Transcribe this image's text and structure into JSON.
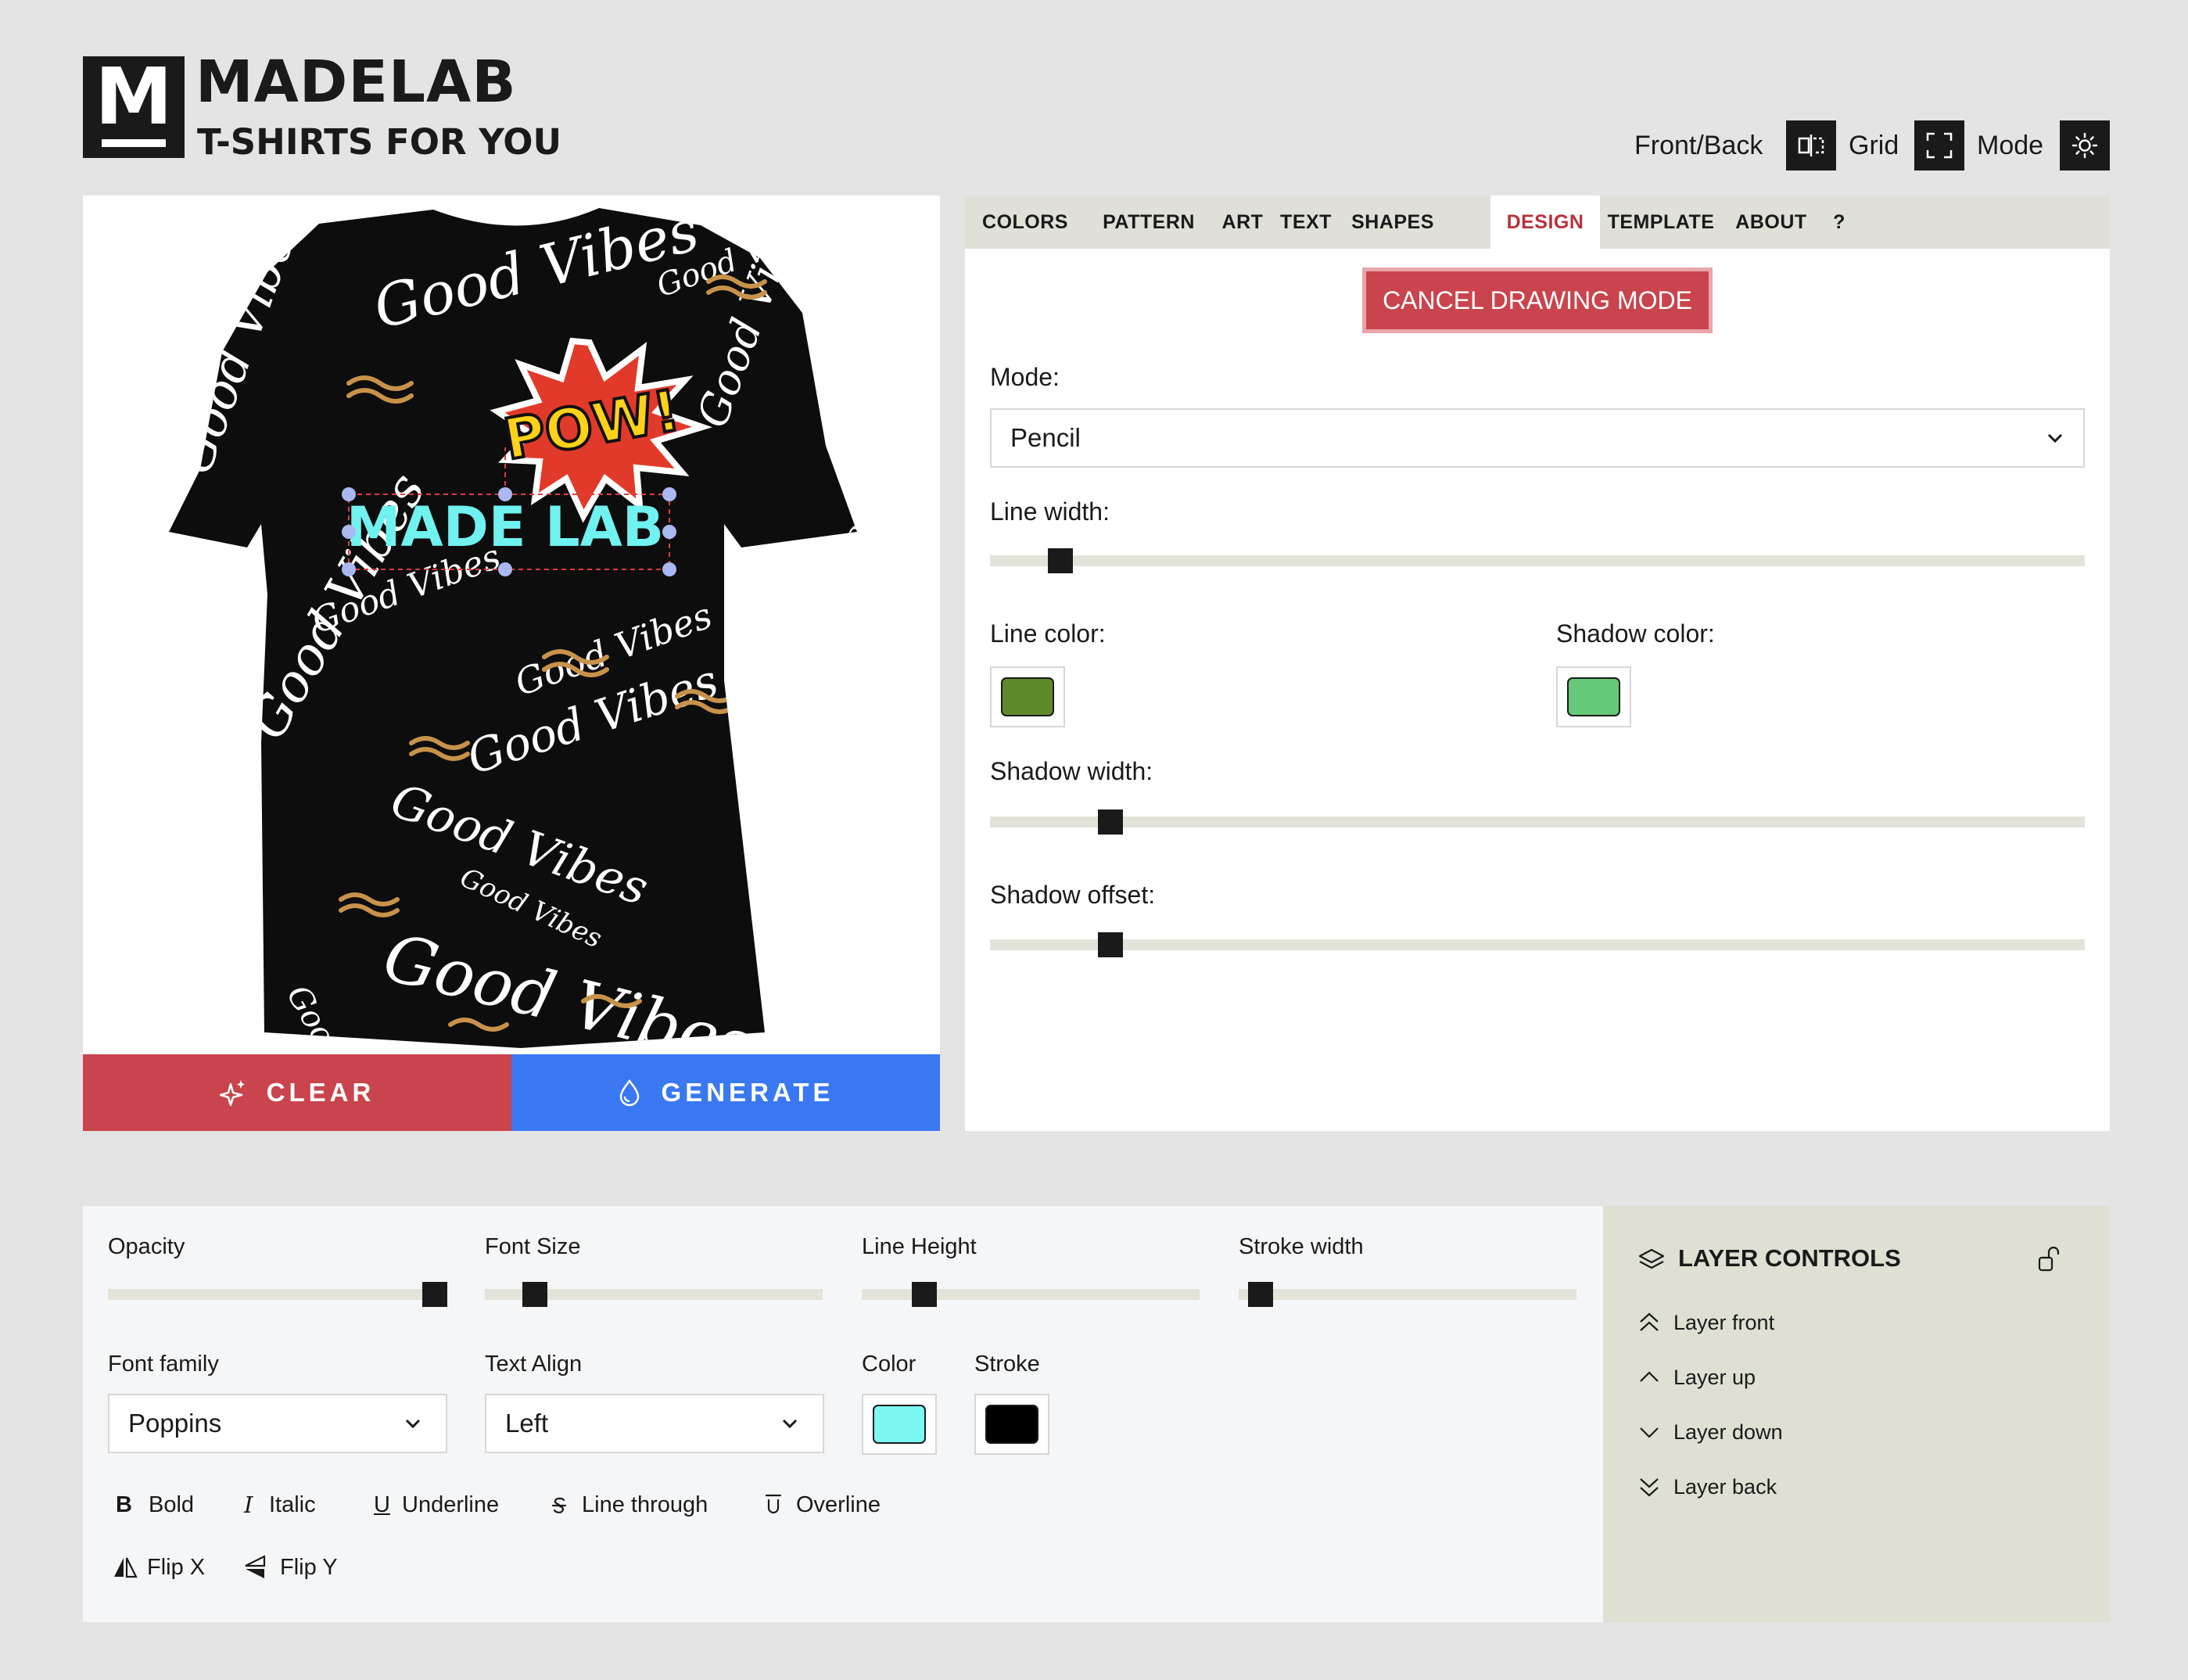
{
  "brand": {
    "logo_letter": "M",
    "title": "MADELAB",
    "subtitle": "T-SHIRTS FOR YOU"
  },
  "toolbar": {
    "front_back": "Front/Back",
    "grid": "Grid",
    "mode": "Mode"
  },
  "canvas": {
    "badge_text": "POW!",
    "selected_text": "MADE LAB",
    "pattern_text": "Good Vibes"
  },
  "actions": {
    "clear": "CLEAR",
    "generate": "GENERATE"
  },
  "tabs": [
    "COLORS",
    "PATTERN",
    "ART",
    "TEXT",
    "SHAPES",
    "DESIGN",
    "TEMPLATE",
    "ABOUT",
    "?"
  ],
  "active_tab": "DESIGN",
  "design": {
    "cancel_label": "CANCEL DRAWING MODE",
    "mode_label": "Mode:",
    "mode_value": "Pencil",
    "line_width_label": "Line width:",
    "line_width_level": 0.06,
    "line_color_label": "Line color:",
    "line_color": "#5f8a2a",
    "shadow_color_label": "Shadow color:",
    "shadow_color": "#66c97a",
    "shadow_width_label": "Shadow width:",
    "shadow_width_level": 0.1,
    "shadow_offset_label": "Shadow offset:",
    "shadow_offset_level": 0.1
  },
  "text_controls": {
    "opacity_label": "Opacity",
    "opacity_level": 0.96,
    "font_size_label": "Font Size",
    "font_size_level": 0.12,
    "line_height_label": "Line Height",
    "line_height_level": 0.16,
    "stroke_width_label": "Stroke width",
    "stroke_width_level": 0.05,
    "font_family_label": "Font family",
    "font_family_value": "Poppins",
    "text_align_label": "Text Align",
    "text_align_value": "Left",
    "color_label": "Color",
    "color_value": "#7df7f2",
    "stroke_label": "Stroke",
    "stroke_value": "#000000",
    "bold": "Bold",
    "bold_glyph": "B",
    "italic": "Italic",
    "italic_glyph": "I",
    "underline": "Underline",
    "underline_glyph": "U",
    "line_through": "Line through",
    "overline": "Overline",
    "flip_x": "Flip X",
    "flip_y": "Flip Y"
  },
  "layers": {
    "title": "LAYER CONTROLS",
    "front": "Layer front",
    "up": "Layer up",
    "down": "Layer down",
    "back": "Layer back"
  },
  "colors": {
    "accent_red": "#c9444c",
    "accent_blue": "#3a78f2",
    "active_tab": "#b8313b",
    "text_cyan": "#6ff2f0"
  },
  "icons": [
    "front-back-icon",
    "grid-icon",
    "sun-icon",
    "sparkle-icon",
    "drop-icon",
    "chevron-down-icon",
    "layers-icon",
    "unlock-icon",
    "double-chevron-up-icon",
    "chevron-up-icon",
    "chevron-down-icon",
    "double-chevron-down-icon",
    "strikethrough-icon",
    "overline-icon",
    "flip-x-icon",
    "flip-y-icon"
  ]
}
